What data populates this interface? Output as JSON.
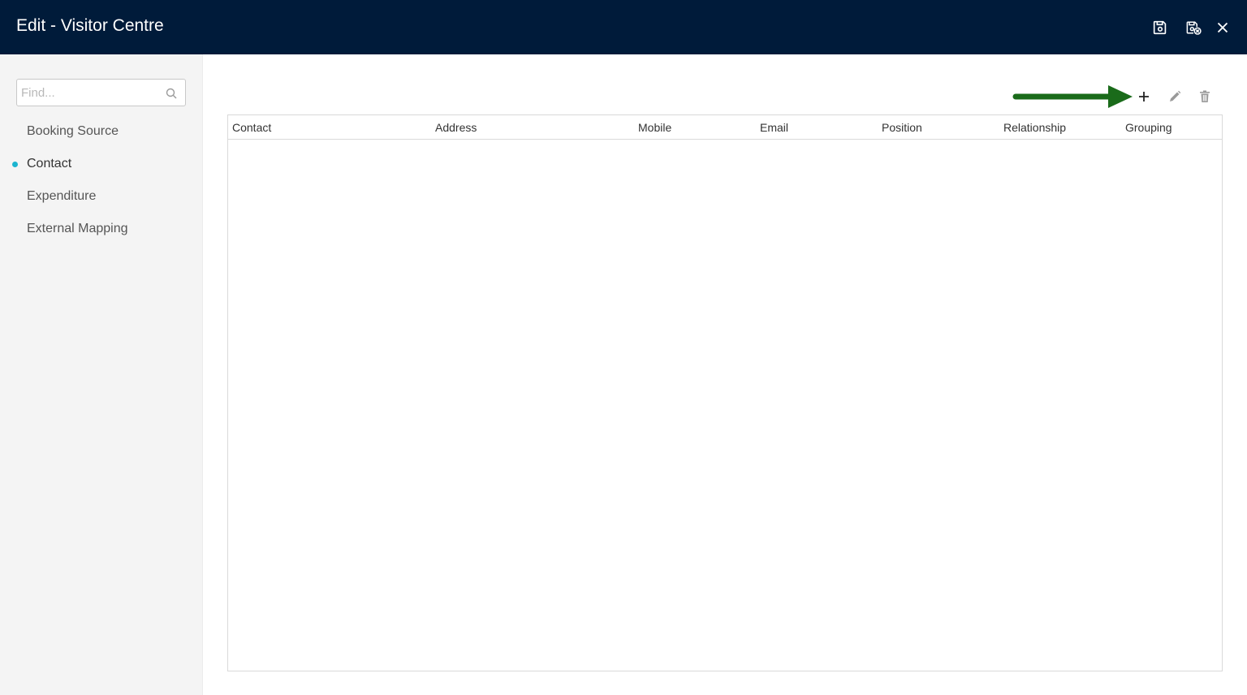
{
  "header": {
    "title": "Edit - Visitor Centre",
    "buttons": [
      {
        "icon": "save-icon"
      },
      {
        "icon": "save-close-icon"
      },
      {
        "icon": "close-icon"
      }
    ]
  },
  "sidebar": {
    "search": {
      "placeholder": "Find...",
      "value": ""
    },
    "items": [
      {
        "label": "Booking Source",
        "active": false
      },
      {
        "label": "Contact",
        "active": true
      },
      {
        "label": "Expenditure",
        "active": false
      },
      {
        "label": "External Mapping",
        "active": false
      }
    ],
    "active_indicator_color": "#1bb4cf"
  },
  "toolbar": {
    "icons": [
      "plus-icon",
      "pencil-icon",
      "trash-icon"
    ]
  },
  "grid": {
    "columns": [
      "Contact",
      "Address",
      "Mobile",
      "Email",
      "Position",
      "Relationship",
      "Grouping"
    ],
    "rows": []
  },
  "colors": {
    "header_bg": "#001b3a",
    "annotation_arrow": "#1a6b1a",
    "sidebar_bg": "#f4f4f4"
  }
}
